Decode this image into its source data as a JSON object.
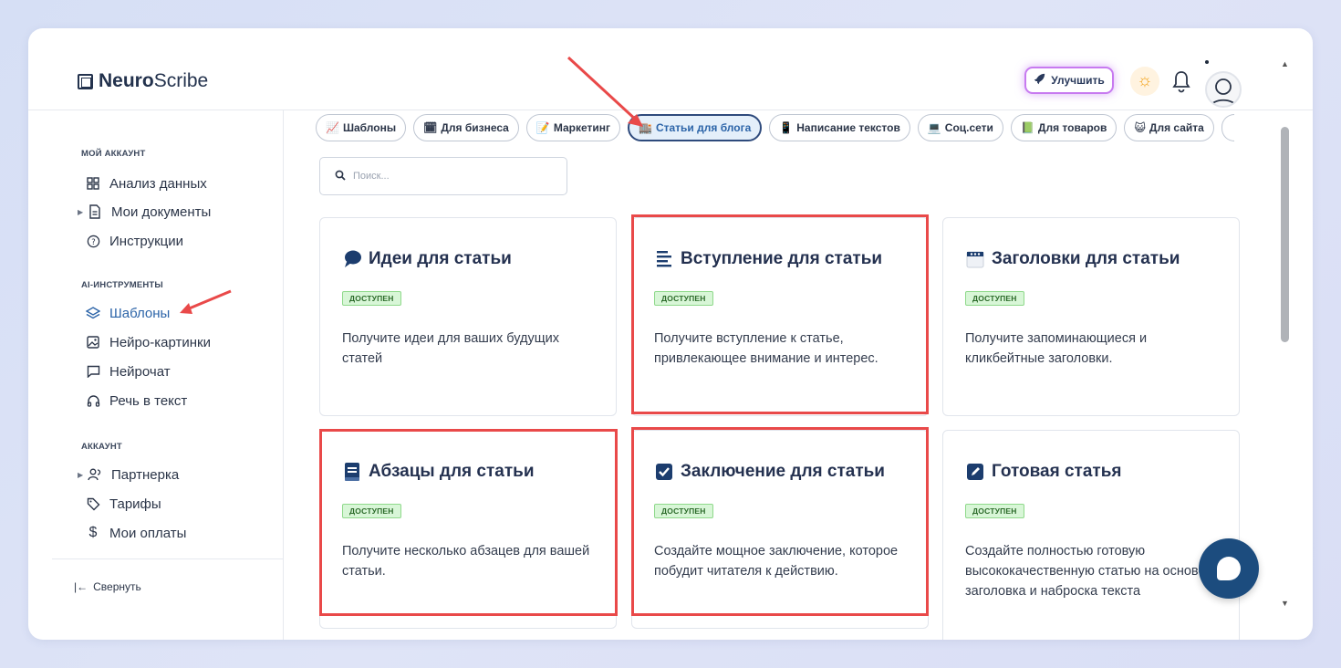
{
  "app": {
    "logo_bold": "Neuro",
    "logo_rest": "Scribe"
  },
  "header": {
    "upgrade_label": "Улучшить"
  },
  "sidebar": {
    "section_account": "МОЙ АККАУНТ",
    "section_ai": "AI-ИНСТРУМЕНТЫ",
    "section_settings": "АККАУНТ",
    "items": {
      "analytics": "Анализ данных",
      "documents": "Мои документы",
      "instructions": "Инструкции",
      "templates": "Шаблоны",
      "images": "Нейро-картинки",
      "chat": "Нейрочат",
      "speech": "Речь в текст",
      "partner": "Партнерка",
      "tariffs": "Тарифы",
      "payments": "Мои оплаты"
    },
    "collapse_label": "Свернуть"
  },
  "tabs": [
    {
      "label": "Шаблоны",
      "icon": "📈"
    },
    {
      "label": "Для бизнеса",
      "icon": "🗓"
    },
    {
      "label": "Маркетинг",
      "icon": "📝"
    },
    {
      "label": "Статьи для блога",
      "icon": "🏬"
    },
    {
      "label": "Написание текстов",
      "icon": "📱"
    },
    {
      "label": "Соц.сети",
      "icon": "💻"
    },
    {
      "label": "Для товаров",
      "icon": "📗"
    },
    {
      "label": "Для сайта",
      "icon": "😺"
    }
  ],
  "search": {
    "placeholder": "Поиск..."
  },
  "cards": [
    {
      "title": "Идеи для статьи",
      "badge": "ДОСТУПЕН",
      "desc": "Получите идеи для ваших будущих статей"
    },
    {
      "title": "Вступление для статьи",
      "badge": "ДОСТУПЕН",
      "desc": "Получите вступление к статье, привлекающее внимание и интерес."
    },
    {
      "title": "Заголовки для статьи",
      "badge": "ДОСТУПЕН",
      "desc": "Получите запоминающиеся и кликбейтные заголовки."
    },
    {
      "title": "Абзацы для статьи",
      "badge": "ДОСТУПЕН",
      "desc": "Получите несколько абзацев для вашей статьи."
    },
    {
      "title": "Заключение для статьи",
      "badge": "ДОСТУПЕН",
      "desc": "Создайте мощное заключение, которое побудит читателя к действию."
    },
    {
      "title": "Готовая статья",
      "badge": "ДОСТУПЕН",
      "desc": "Создайте полностью готовую высококачественную статью на основе заголовка и наброска текста"
    }
  ],
  "colors": {
    "accent": "#2c64a8",
    "highlight": "#e94949",
    "badge_bg": "#d8f6d7",
    "chat": "#1c4c7e"
  }
}
